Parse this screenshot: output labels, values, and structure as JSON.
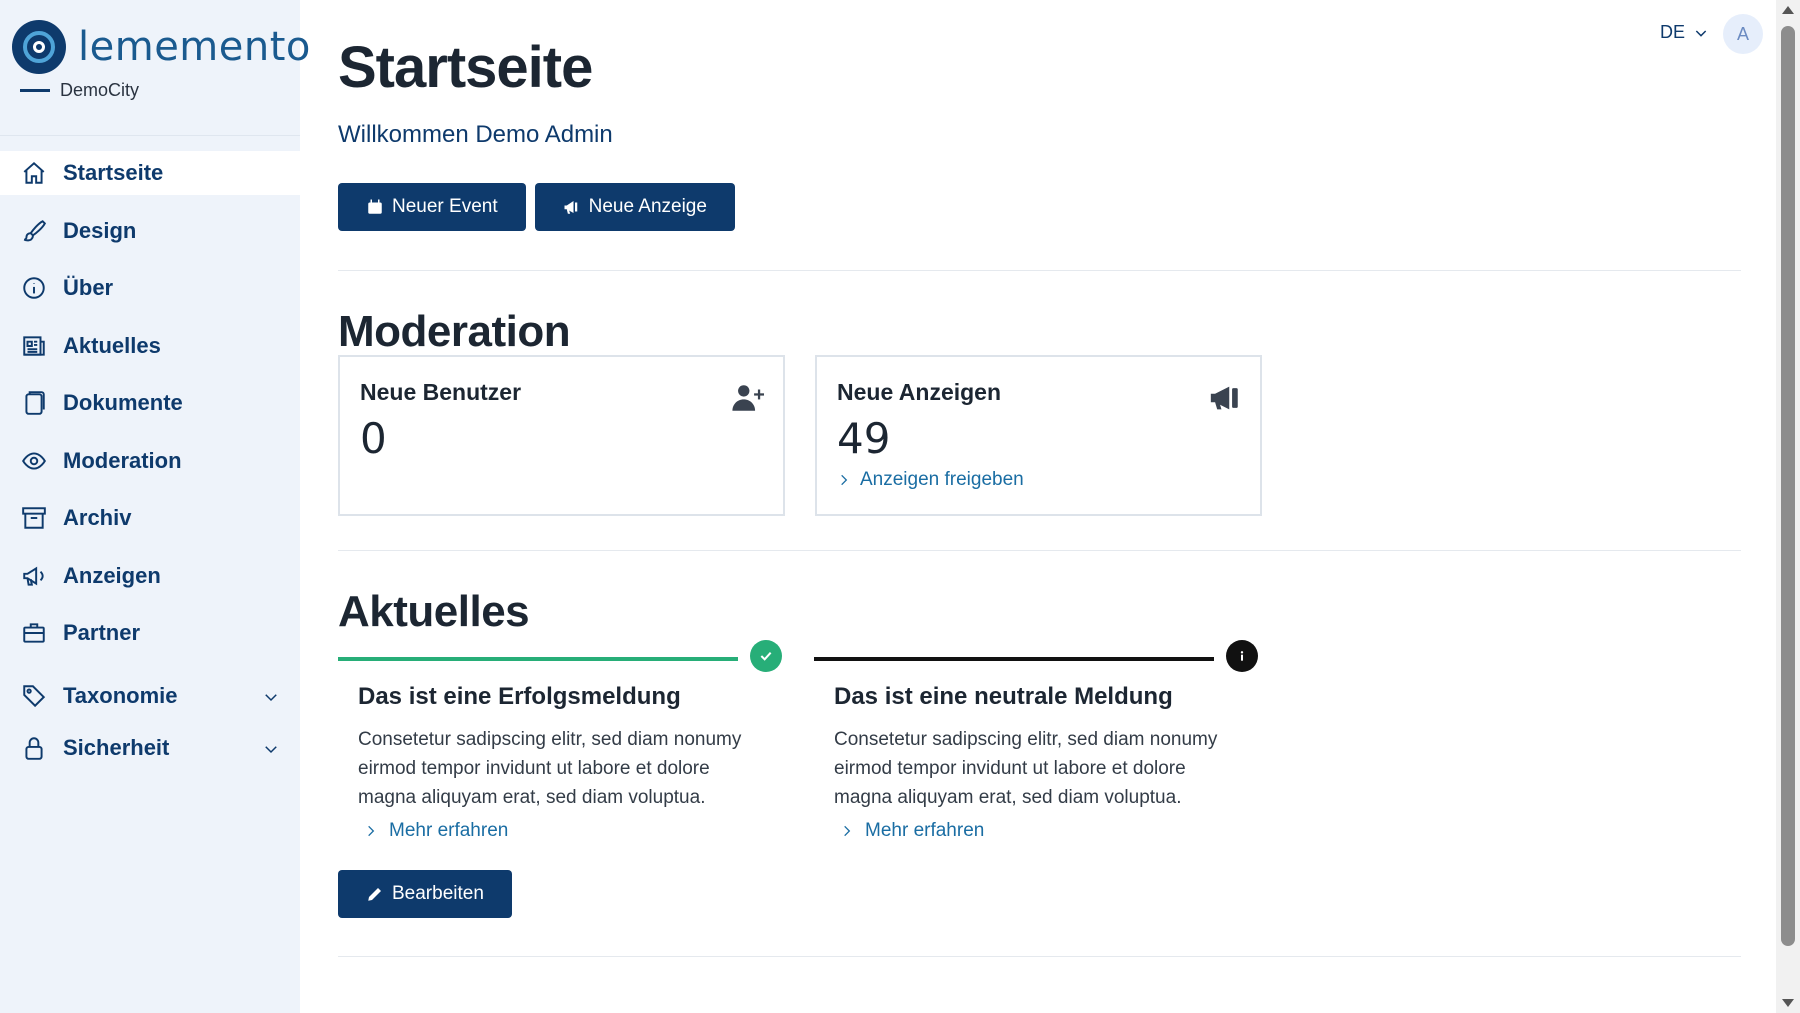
{
  "brand": {
    "logo_text": "lememento",
    "org_name": "DemoCity"
  },
  "sidebar": {
    "items": [
      {
        "label": "Startseite",
        "icon": "home-icon",
        "active": true
      },
      {
        "label": "Design",
        "icon": "brush-icon"
      },
      {
        "label": "Über",
        "icon": "info-icon"
      },
      {
        "label": "Aktuelles",
        "icon": "newspaper-icon"
      },
      {
        "label": "Dokumente",
        "icon": "document-icon"
      },
      {
        "label": "Moderation",
        "icon": "eye-icon"
      },
      {
        "label": "Archiv",
        "icon": "archive-icon"
      },
      {
        "label": "Anzeigen",
        "icon": "megaphone-icon"
      },
      {
        "label": "Partner",
        "icon": "briefcase-icon"
      },
      {
        "label": "Taxonomie",
        "icon": "tag-icon",
        "expandable": true
      },
      {
        "label": "Sicherheit",
        "icon": "lock-icon",
        "expandable": true
      }
    ]
  },
  "header": {
    "language": "DE",
    "avatar_initial": "A"
  },
  "main": {
    "title": "Startseite",
    "welcome": "Willkommen Demo Admin",
    "buttons": {
      "new_event": "Neuer Event",
      "new_ad": "Neue Anzeige"
    },
    "moderation": {
      "title": "Moderation",
      "cards": [
        {
          "title": "Neue Benutzer",
          "value": "0",
          "icon": "user-plus-icon"
        },
        {
          "title": "Neue Anzeigen",
          "value": "49",
          "icon": "megaphone-icon",
          "link": "Anzeigen freigeben"
        }
      ]
    },
    "news": {
      "title": "Aktuelles",
      "items": [
        {
          "title": "Das ist eine Erfolgsmeldung",
          "text": "Consetetur sadipscing elitr, sed diam nonumy eirmod tempor invidunt ut labore et dolore magna aliquyam erat, sed diam voluptua.",
          "link": "Mehr erfahren",
          "status": "success",
          "color": "#27ae78"
        },
        {
          "title": "Das ist eine neutrale Meldung",
          "text": "Consetetur sadipscing elitr, sed diam nonumy eirmod tempor invidunt ut labore et dolore magna aliquyam erat, sed diam voluptua.",
          "link": "Mehr erfahren",
          "status": "info",
          "color": "#111111"
        }
      ],
      "edit_button": "Bearbeiten"
    }
  },
  "colors": {
    "primary": "#0e3a6c",
    "link": "#1a6da3",
    "sidebar_bg": "#eef3fa"
  }
}
